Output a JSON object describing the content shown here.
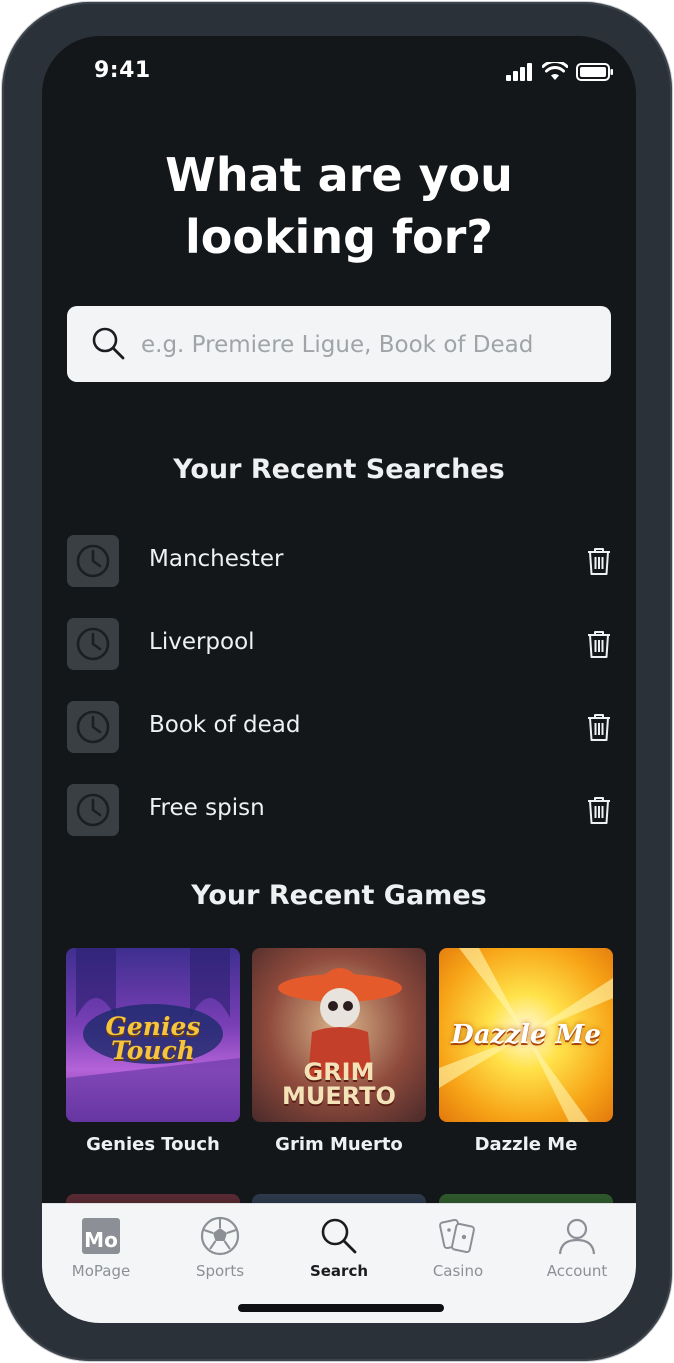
{
  "status_bar": {
    "time": "9:41"
  },
  "headline": {
    "line1": "What are you",
    "line2": "looking for?"
  },
  "search": {
    "placeholder": "e.g. Premiere Ligue, Book of Dead",
    "value": ""
  },
  "recent_searches": {
    "title": "Your Recent Searches",
    "items": [
      {
        "label": "Manchester"
      },
      {
        "label": "Liverpool"
      },
      {
        "label": "Book of dead"
      },
      {
        "label": "Free spisn"
      }
    ]
  },
  "recent_games": {
    "title": "Your Recent Games",
    "items": [
      {
        "title": "Genies Touch",
        "logo_line1": "Genies",
        "logo_line2": "Touch"
      },
      {
        "title": "Grim Muerto",
        "logo_line1": "GRIM",
        "logo_line2": "MUERTO"
      },
      {
        "title": "Dazzle Me",
        "logo_line1": "Dazzle Me",
        "logo_line2": ""
      }
    ]
  },
  "tab_bar": {
    "active": "Search",
    "tabs": [
      {
        "label": "MoPage",
        "icon": "mopage-logo-icon",
        "logo_text": "Mo"
      },
      {
        "label": "Sports",
        "icon": "soccer-ball-icon"
      },
      {
        "label": "Search",
        "icon": "search-icon"
      },
      {
        "label": "Casino",
        "icon": "playing-cards-icon"
      },
      {
        "label": "Account",
        "icon": "user-icon"
      }
    ]
  },
  "colors": {
    "background": "#141719",
    "phone_frame": "#2b3138",
    "text": "#eef0f2",
    "muted": "#8c9096",
    "search_bg": "#f3f4f5",
    "tab_bar_bg": "#f4f5f6"
  }
}
